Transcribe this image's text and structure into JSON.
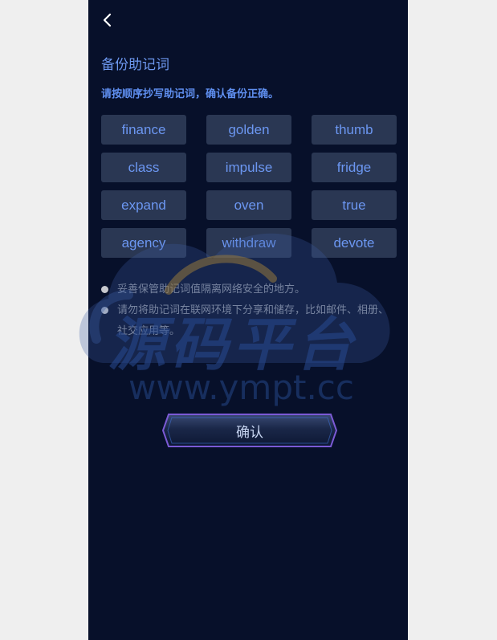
{
  "header": {
    "back_icon": "chevron-left-icon"
  },
  "page": {
    "title": "备份助记词",
    "subtitle": "请按顺序抄写助记词，确认备份正确。"
  },
  "words": [
    "finance",
    "golden",
    "thumb",
    "class",
    "impulse",
    "fridge",
    "expand",
    "oven",
    "true",
    "agency",
    "withdraw",
    "devote"
  ],
  "tips": [
    "妥善保管助记词值隔离网络安全的地方。",
    "请勿将助记词在联网环境下分享和储存，比如邮件、相册、社交应用等。"
  ],
  "confirm_label": "确认",
  "watermark": {
    "cn": "源码平台",
    "en": "www.ympt.cc"
  },
  "colors": {
    "background": "#07102a",
    "accent": "#6d98f0",
    "word_bg": "#2a3753",
    "button_border": "#7b5ad6"
  }
}
